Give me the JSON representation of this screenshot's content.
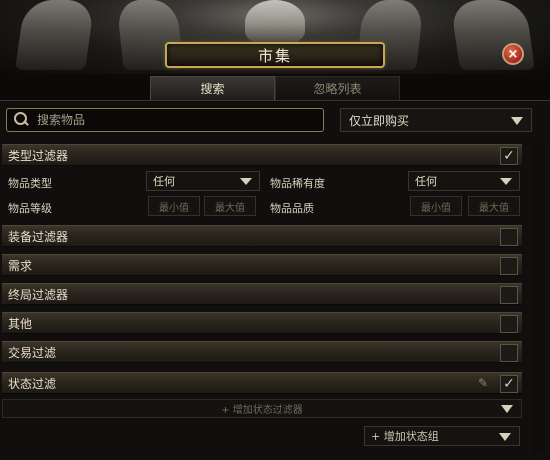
{
  "window": {
    "title": "市集",
    "close_label": "×"
  },
  "tabs": [
    {
      "label": "搜索",
      "active": true
    },
    {
      "label": "忽略列表",
      "active": false
    }
  ],
  "search": {
    "placeholder": "搜索物品",
    "value": ""
  },
  "buy_mode": {
    "selected": "仅立即购买"
  },
  "type_filters": {
    "label": "类型过滤器",
    "checked": true,
    "item_category_label": "物品类型",
    "item_category_value": "任何",
    "item_rarity_label": "物品稀有度",
    "item_rarity_value": "任何",
    "item_level_label": "物品等级",
    "item_quality_label": "物品品质",
    "min_placeholder": "最小值",
    "max_placeholder": "最大值"
  },
  "filter_groups": [
    {
      "label": "装备过滤器",
      "checked": false
    },
    {
      "label": "需求",
      "checked": false
    },
    {
      "label": "终局过滤器",
      "checked": false
    },
    {
      "label": "其他",
      "checked": false
    },
    {
      "label": "交易过滤",
      "checked": false
    }
  ],
  "stat_filters": {
    "label": "状态过滤",
    "checked": true
  },
  "add_stat_filter": "+ 增加状态过滤器",
  "add_stat_group": "+ 增加状态组",
  "check_mark": "✓",
  "colors": {
    "accent_gold": "#c7a85a",
    "close_red": "#a2281a"
  }
}
